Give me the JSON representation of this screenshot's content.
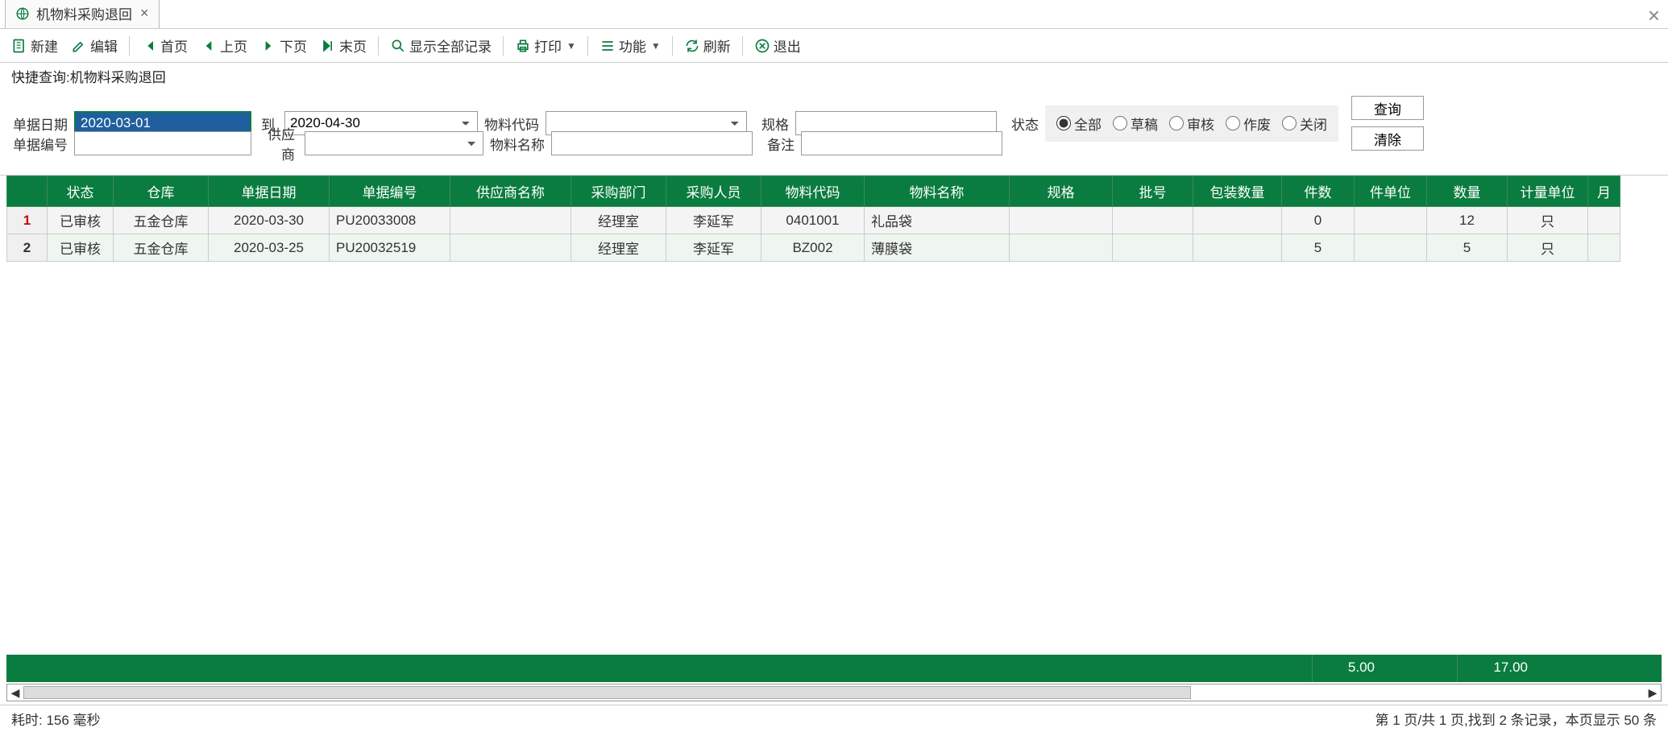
{
  "tab": {
    "title": "机物料采购退回"
  },
  "toolbar": {
    "new": "新建",
    "edit": "编辑",
    "first": "首页",
    "prev": "上页",
    "next": "下页",
    "last": "末页",
    "show_all": "显示全部记录",
    "print": "打印",
    "function": "功能",
    "refresh": "刷新",
    "exit": "退出"
  },
  "quick_label": "快捷查询:机物料采购退回",
  "filter": {
    "date_label": "单据日期",
    "date_start": "2020-03-01",
    "to_label": "到",
    "date_end": "2020-04-30",
    "material_code_label": "物料代码",
    "spec_label": "规格",
    "doc_no_label": "单据编号",
    "supplier_label": "供应商",
    "material_name_label": "物料名称",
    "remark_label": "备注",
    "status_label": "状态",
    "status_options": {
      "all": "全部",
      "draft": "草稿",
      "audit": "审核",
      "void": "作废",
      "close": "关闭"
    },
    "query_btn": "查询",
    "clear_btn": "清除"
  },
  "table": {
    "headers": [
      "",
      "状态",
      "仓库",
      "单据日期",
      "单据编号",
      "供应商名称",
      "采购部门",
      "采购人员",
      "物料代码",
      "物料名称",
      "规格",
      "批号",
      "包装数量",
      "件数",
      "件单位",
      "数量",
      "计量单位",
      "月"
    ],
    "rows": [
      {
        "n": "1",
        "status": "已审核",
        "warehouse": "五金仓库",
        "date": "2020-03-30",
        "doc": "PU20033008",
        "supplier": "",
        "dept": "经理室",
        "person": "李延军",
        "code": "0401001",
        "name": "礼品袋",
        "spec": "",
        "batch": "",
        "pack_qty": "",
        "pieces": "0",
        "piece_unit": "",
        "qty": "12",
        "unit": "只"
      },
      {
        "n": "2",
        "status": "已审核",
        "warehouse": "五金仓库",
        "date": "2020-03-25",
        "doc": "PU20032519",
        "supplier": "",
        "dept": "经理室",
        "person": "李延军",
        "code": "BZ002",
        "name": "薄膜袋",
        "spec": "",
        "batch": "",
        "pack_qty": "",
        "pieces": "5",
        "piece_unit": "",
        "qty": "5",
        "unit": "只"
      }
    ]
  },
  "summary": {
    "pieces": "5.00",
    "qty": "17.00"
  },
  "status_bar": {
    "left": "耗时: 156 毫秒",
    "right": "第 1 页/共 1 页,找到 2 条记录，本页显示 50 条"
  }
}
